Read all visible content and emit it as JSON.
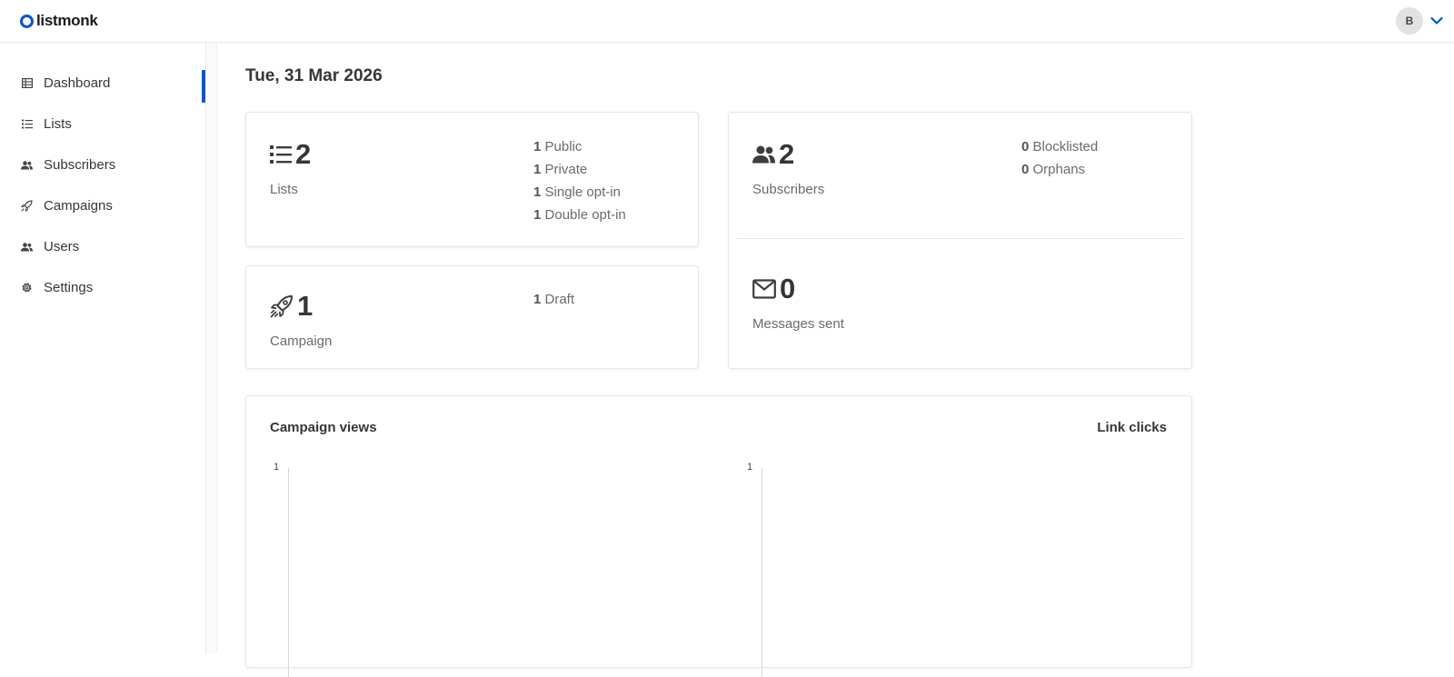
{
  "brand": {
    "name": "listmonk",
    "accent": "#0055d4"
  },
  "user": {
    "avatar_initial": "B"
  },
  "sidebar": {
    "items": [
      {
        "label": "Dashboard",
        "icon": "grid-icon",
        "active": true
      },
      {
        "label": "Lists",
        "icon": "list-icon",
        "active": false
      },
      {
        "label": "Subscribers",
        "icon": "users-icon",
        "active": false
      },
      {
        "label": "Campaigns",
        "icon": "rocket-icon",
        "active": false
      },
      {
        "label": "Users",
        "icon": "users-icon",
        "active": false
      },
      {
        "label": "Settings",
        "icon": "gear-icon",
        "active": false
      }
    ]
  },
  "dashboard": {
    "date": "Tue, 31 Mar 2026",
    "lists": {
      "count": "2",
      "label": "Lists",
      "breakdown": [
        {
          "value": "1",
          "label": "Public"
        },
        {
          "value": "1",
          "label": "Private"
        },
        {
          "value": "1",
          "label": "Single opt-in"
        },
        {
          "value": "1",
          "label": "Double opt-in"
        }
      ]
    },
    "campaigns": {
      "count": "1",
      "label": "Campaign",
      "breakdown": [
        {
          "value": "1",
          "label": "Draft"
        }
      ]
    },
    "subscribers": {
      "count": "2",
      "label": "Subscribers",
      "breakdown": [
        {
          "value": "0",
          "label": "Blocklisted"
        },
        {
          "value": "0",
          "label": "Orphans"
        }
      ]
    },
    "messages": {
      "count": "0",
      "label": "Messages sent"
    }
  },
  "charts": {
    "views": {
      "title": "Campaign views",
      "y_tick": "1"
    },
    "clicks": {
      "title": "Link clicks",
      "y_tick": "1"
    }
  }
}
